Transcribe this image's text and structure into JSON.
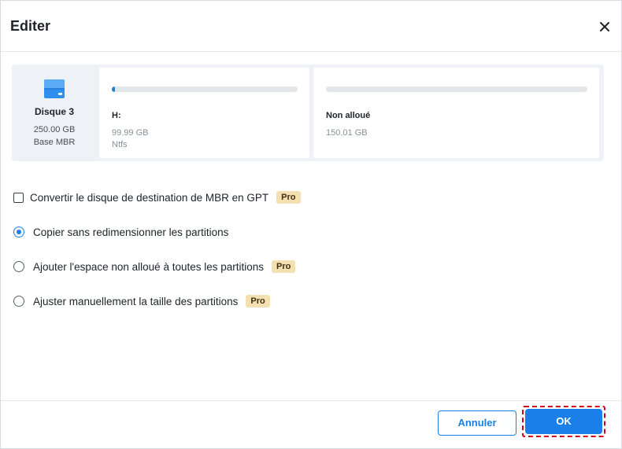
{
  "dialog": {
    "title": "Editer"
  },
  "disk": {
    "name": "Disque 3",
    "size": "250.00 GB",
    "type": "Base MBR",
    "icon": "disk-icon"
  },
  "partitions": [
    {
      "label": "H:",
      "size": "99.99 GB",
      "filesystem": "Ntfs",
      "usage_fraction": 0.01
    },
    {
      "label": "Non alloué",
      "size": "150.01 GB",
      "filesystem": "",
      "usage_fraction": 0
    }
  ],
  "options": {
    "convert_gpt": {
      "label": "Convertir le disque de destination de MBR en GPT",
      "badge": "Pro",
      "checked": false
    },
    "copy_no_resize": {
      "label": "Copier sans redimensionner les partitions",
      "checked": true
    },
    "add_unallocated": {
      "label": "Ajouter l'espace non alloué à toutes les partitions",
      "badge": "Pro",
      "checked": false
    },
    "manual_resize": {
      "label": "Ajuster manuellement la taille des partitions",
      "badge": "Pro",
      "checked": false
    }
  },
  "buttons": {
    "cancel": "Annuler",
    "ok": "OK"
  },
  "colors": {
    "accent": "#1a7fe8",
    "pro_badge": "#f3dfb0",
    "highlight_frame": "#d0021b"
  }
}
